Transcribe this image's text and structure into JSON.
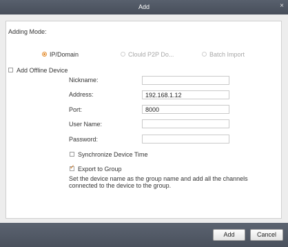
{
  "dialog": {
    "title": "Add",
    "close_glyph": "×"
  },
  "adding_mode": {
    "label": "Adding Mode:",
    "options": [
      {
        "label": "IP/Domain",
        "selected": true,
        "enabled": true
      },
      {
        "label": "Clould P2P Do...",
        "selected": false,
        "enabled": false
      },
      {
        "label": "Batch Import",
        "selected": false,
        "enabled": false
      }
    ]
  },
  "offline": {
    "label": "Add Offline Device",
    "checked": false
  },
  "form": {
    "nickname_label": "Nickname:",
    "nickname_value": "",
    "address_label": "Address:",
    "address_value": "192.168.1.12",
    "port_label": "Port:",
    "port_value": "8000",
    "username_label": "User Name:",
    "username_value": "",
    "password_label": "Password:",
    "password_value": ""
  },
  "sync_time": {
    "label": "Synchronize Device Time",
    "checked": false
  },
  "export_group": {
    "label": "Export to Group",
    "checked": true,
    "description_line1": "Set the device name as the group name and add all the channels",
    "description_line2": "connected to the device to the group."
  },
  "buttons": {
    "add": "Add",
    "cancel": "Cancel"
  },
  "colors": {
    "title_bar": "#4f5763",
    "accent": "#e38a2a",
    "panel_bg": "#ffffff",
    "dialog_bg": "#ededed"
  }
}
